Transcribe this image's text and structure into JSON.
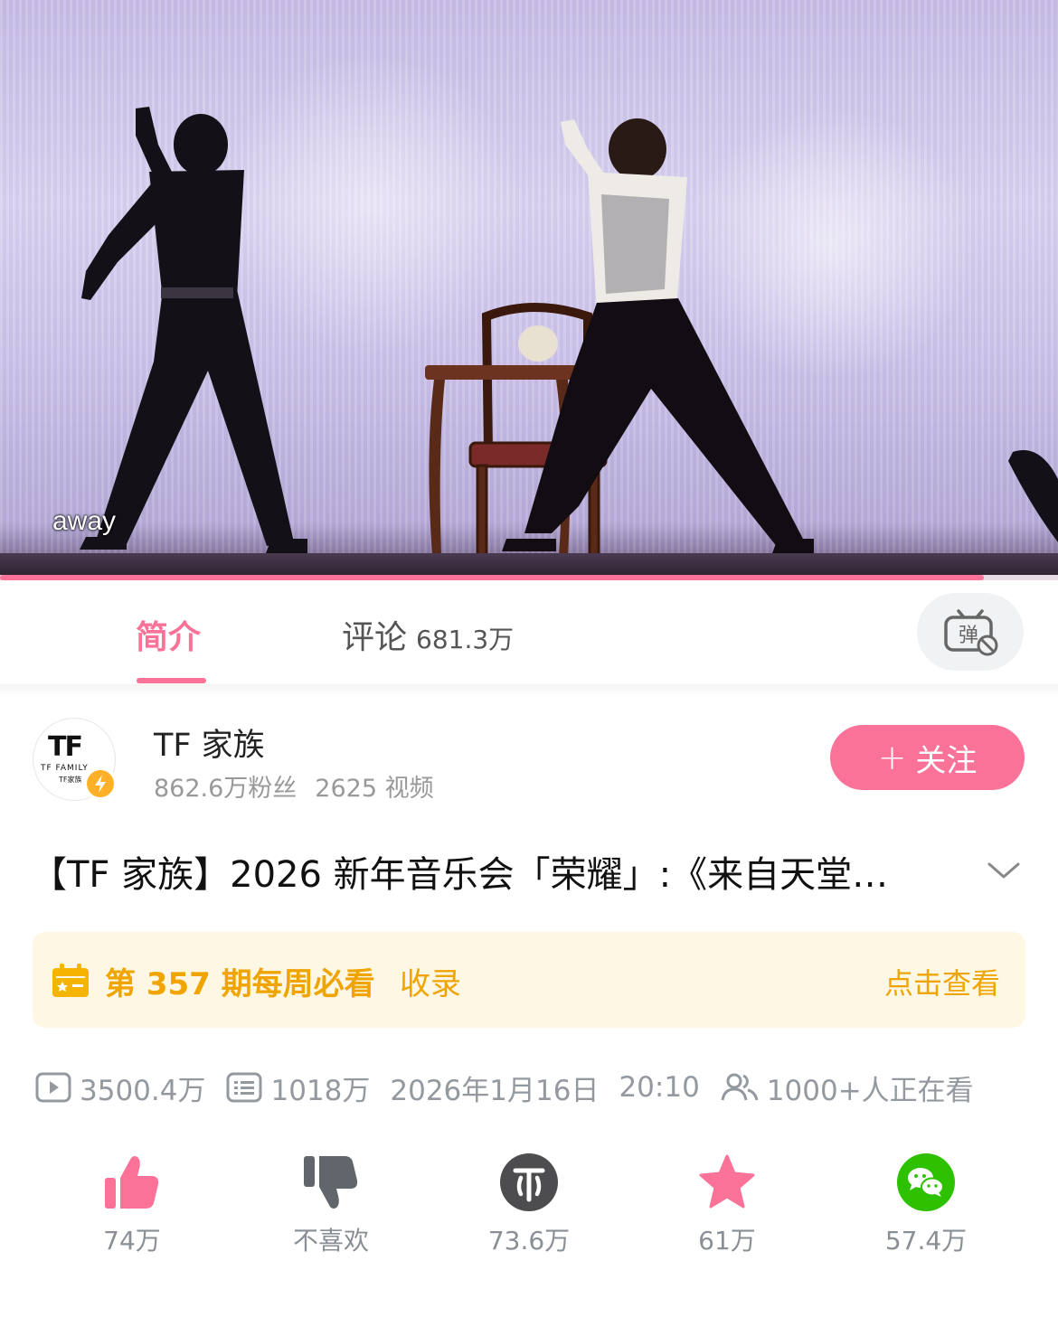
{
  "video": {
    "subtitle": "away",
    "progress_fraction": 0.93
  },
  "tabs": {
    "intro_label": "简介",
    "comments_label": "评论",
    "comments_count": "681.3万",
    "danmaku_icon_char": "弹"
  },
  "uploader": {
    "name": "TF 家族",
    "followers": "862.6万粉丝",
    "videos": "2625 视频",
    "avatar_logo": "TF",
    "avatar_sub": "TF FAMILY",
    "avatar_sub2": "TF家族"
  },
  "follow_button": {
    "plus": "+",
    "label": "关注"
  },
  "title": "【TF 家族】2026 新年音乐会「荣耀」:《来自天堂…",
  "weekly": {
    "title": "第 357 期每周必看",
    "suffix": "收录",
    "link": "点击查看"
  },
  "stats": {
    "plays": "3500.4万",
    "danmaku": "1018万",
    "date": "2026年1月16日",
    "time": "20:10",
    "watching": "1000+人正在看"
  },
  "actions": [
    {
      "name": "like",
      "label": "74万"
    },
    {
      "name": "dislike",
      "label": "不喜欢"
    },
    {
      "name": "coin",
      "label": "73.6万"
    },
    {
      "name": "favorite",
      "label": "61万"
    },
    {
      "name": "share",
      "label": "57.4万"
    }
  ],
  "colors": {
    "accent": "#fb7299",
    "weekly_text": "#f0a400",
    "weekly_bg": "#fdf7e3",
    "muted": "#9499a0",
    "coin": "#4d4d4f",
    "wechat": "#2dc100"
  }
}
